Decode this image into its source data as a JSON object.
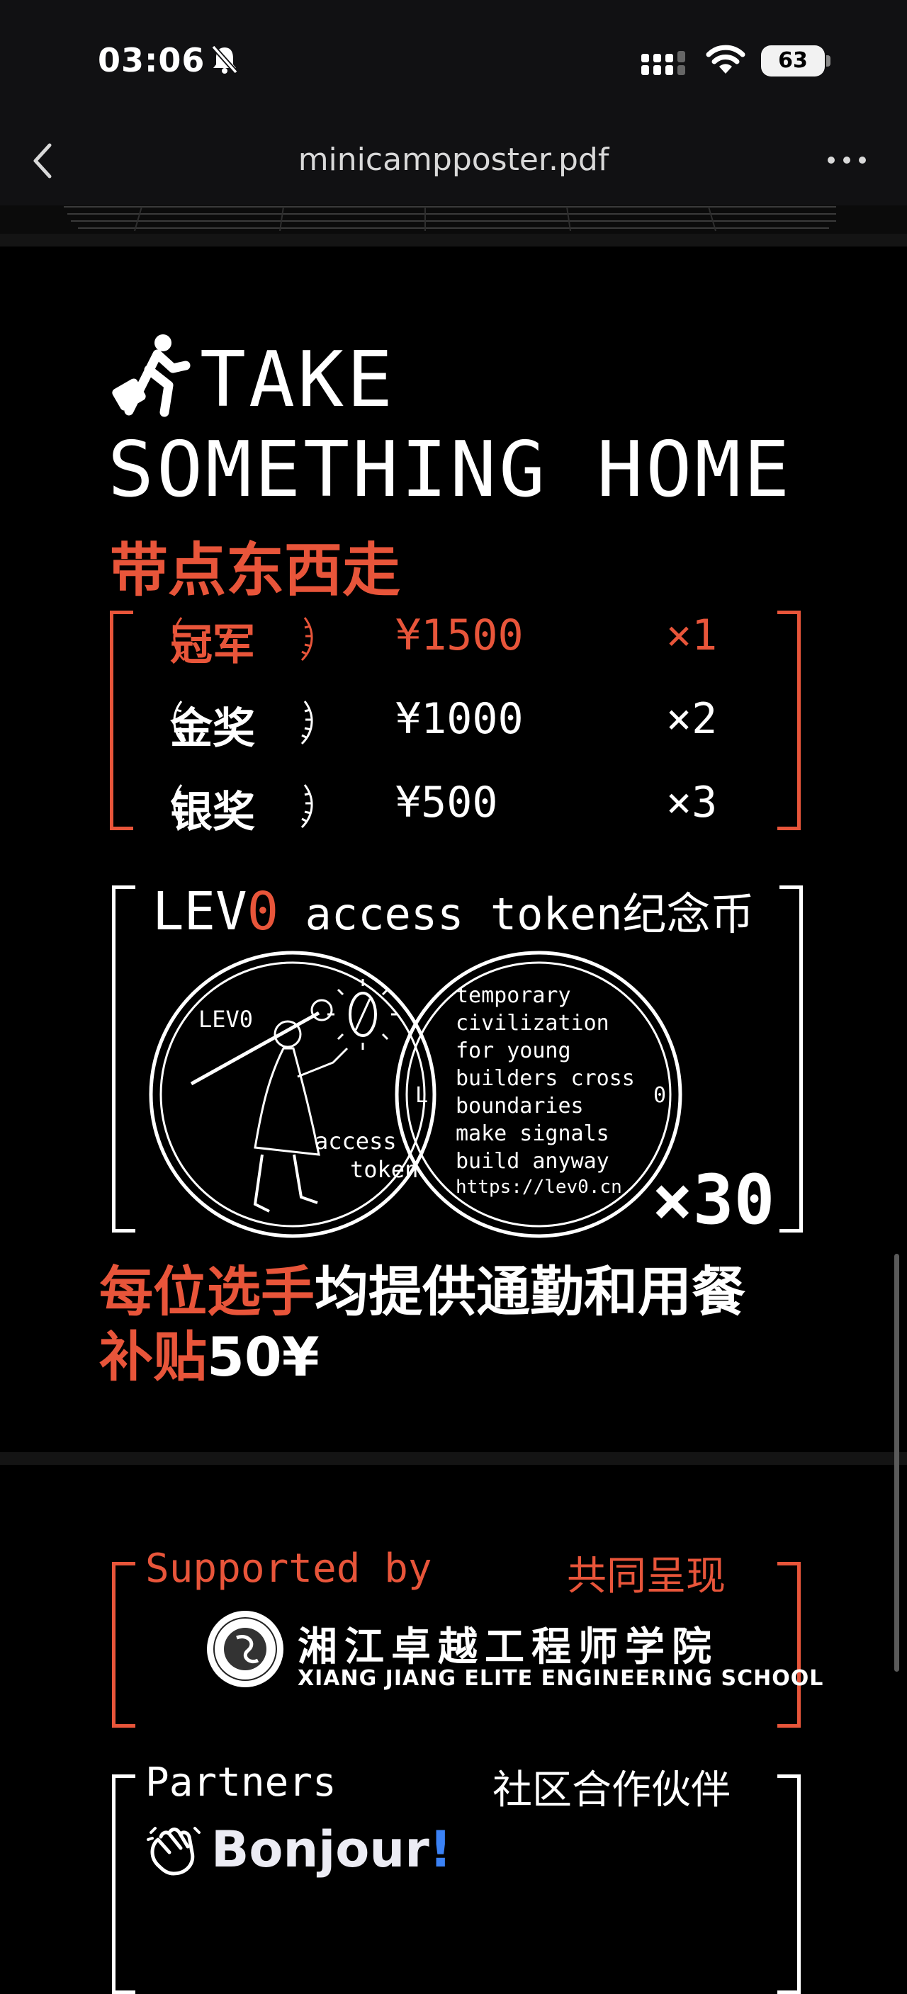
{
  "status_bar": {
    "time": "03:06",
    "battery": "63"
  },
  "nav": {
    "title": "minicampposter.pdf"
  },
  "poster": {
    "heading_line1": "TAKE",
    "heading_line2": "SOMETHING HOME",
    "heading_cn": "带点东西走",
    "prizes": [
      {
        "name": "冠军",
        "amount": "¥1500",
        "count": "×1"
      },
      {
        "name": "金奖",
        "amount": "¥1000",
        "count": "×2"
      },
      {
        "name": "银奖",
        "amount": "¥500",
        "count": "×3"
      }
    ],
    "token": {
      "title_lev": "LEV",
      "title_zero": "0",
      "title_rest": " access token纪念币",
      "coin1_top": "LEV0",
      "coin1_line1": "access",
      "coin1_line2": "token",
      "coin2_lines": [
        "temporary",
        "civilization",
        "for young",
        "builders cross",
        "boundaries",
        "make signals",
        "build anyway",
        "https://lev0.cn"
      ],
      "coin2_left": "L",
      "coin2_right": "0",
      "quantity": "×30"
    },
    "meal_highlight": "每位选手",
    "meal_rest": "均提供通勤和用餐",
    "meal_line2_red": "补贴",
    "meal_line2_white": "50¥",
    "supported_label": "Supported by",
    "supported_cn": "共同呈现",
    "school_cn": "湘江卓越工程师学院",
    "school_en": "XIANG JIANG ELITE ENGINEERING SCHOOL",
    "partners_label": "Partners",
    "partners_cn": "社区合作伙伴",
    "partner_name": "Bonjour",
    "partner_bang": "!"
  },
  "colors": {
    "accent": "#e8553a",
    "background": "#000000",
    "bonjour_blue": "#3b82f6"
  }
}
